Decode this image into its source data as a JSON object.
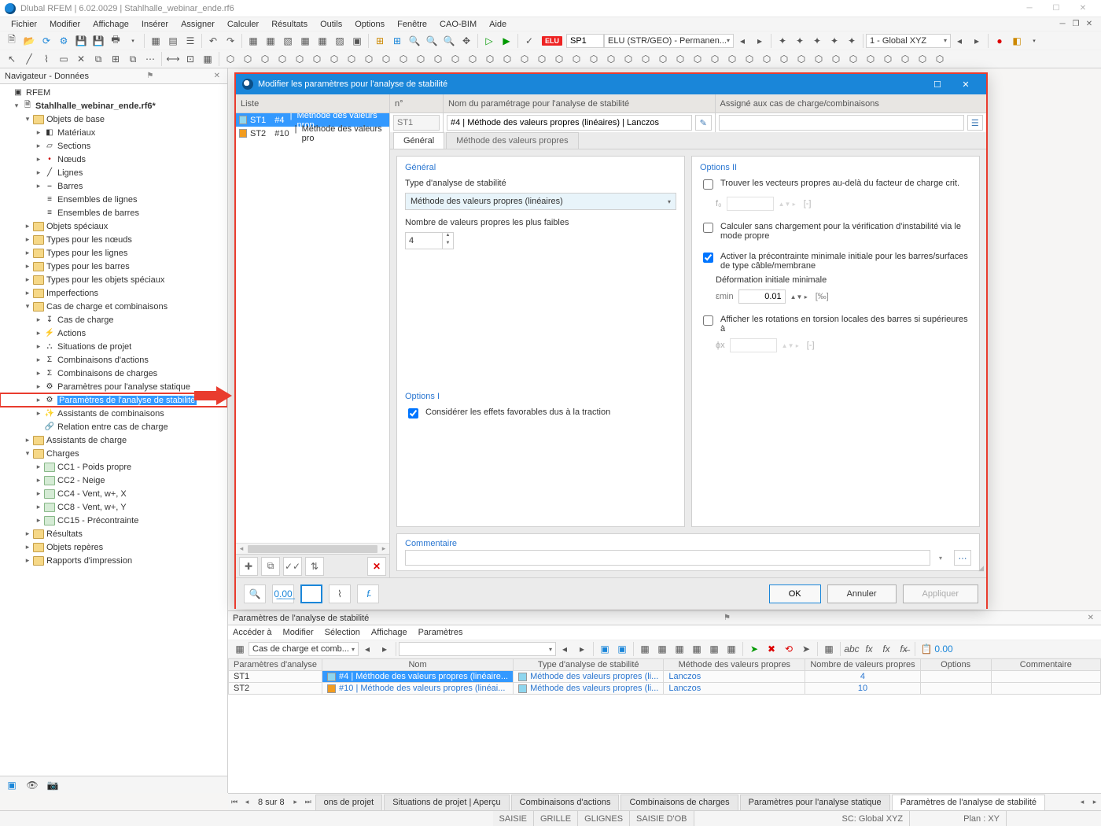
{
  "window_title": "Dlubal RFEM | 6.02.0029 | Stahlhalle_webinar_ende.rf6",
  "menus": [
    "Fichier",
    "Modifier",
    "Affichage",
    "Insérer",
    "Assigner",
    "Calculer",
    "Résultats",
    "Outils",
    "Options",
    "Fenêtre",
    "CAO-BIM",
    "Aide"
  ],
  "toolbar1": {
    "elu_label": "ELU",
    "sp_input": "SP1",
    "combo": "ELU (STR/GEO) - Permanen...",
    "coord": "1 - Global XYZ"
  },
  "navigator": {
    "title": "Navigateur - Données",
    "root": "RFEM",
    "file": "Stahlhalle_webinar_ende.rf6*",
    "objets_base": "Objets de base",
    "base_children": [
      "Matériaux",
      "Sections",
      "Nœuds",
      "Lignes",
      "Barres",
      "Ensembles de lignes",
      "Ensembles de barres"
    ],
    "others": [
      "Objets spéciaux",
      "Types pour les nœuds",
      "Types pour les lignes",
      "Types pour les barres",
      "Types pour les objets spéciaux",
      "Imperfections"
    ],
    "cas_charge": "Cas de charge et combinaisons",
    "cas_children": [
      "Cas de charge",
      "Actions",
      "Situations de projet",
      "Combinaisons d'actions",
      "Combinaisons de charges",
      "Paramètres pour l'analyse statique",
      "Paramètres de l'analyse de stabilité",
      "Assistants de combinaisons",
      "Relation entre cas de charge"
    ],
    "assistants": "Assistants de charge",
    "charges": "Charges",
    "charges_children": [
      "CC1 - Poids propre",
      "CC2 - Neige",
      "CC4 - Vent, w+, X",
      "CC8 - Vent, w+, Y",
      "CC15 - Précontrainte"
    ],
    "last": [
      "Résultats",
      "Objets repères",
      "Rapports d'impression"
    ]
  },
  "dialog": {
    "title": "Modifier les paramètres pour l'analyse de stabilité",
    "list_head": "Liste",
    "list": [
      {
        "id": "ST1",
        "num": "#4",
        "name": "Méthode des valeurs propres (linéaires) | Lanczos",
        "color": "cyan"
      },
      {
        "id": "ST2",
        "num": "#10",
        "name": "Méthode des valeurs propres (linéaires) | Lanczos",
        "color": "orange"
      }
    ],
    "cols": {
      "no_head": "n°",
      "no_val": "ST1",
      "name_head": "Nom du paramétrage pour l'analyse de stabilité",
      "name_val": "#4 | Méthode des valeurs propres (linéaires) | Lanczos",
      "assigned_head": "Assigné aux cas de charge/combinaisons",
      "assigned_val": ""
    },
    "tabs": [
      "Général",
      "Méthode des valeurs propres"
    ],
    "general_group": "Général",
    "type_label": "Type d'analyse de stabilité",
    "type_value": "Méthode des valeurs propres (linéaires)",
    "nvp_label": "Nombre de valeurs propres les plus faibles",
    "nvp_value": "4",
    "options1": "Options I",
    "opt1_1": "Considérer les effets favorables dus à la traction",
    "options2": "Options II",
    "opt2_1": "Trouver les vecteurs propres au-delà du facteur de charge crit.",
    "f0_label": "f₀",
    "f0_unit": "[-]",
    "opt2_2": "Calculer sans chargement pour la vérification d'instabilité via le mode propre",
    "opt2_3": "Activer la précontrainte minimale initiale pour les barres/surfaces de type câble/membrane",
    "deform_label": "Déformation initiale minimale",
    "emin_label": "εmin",
    "emin_val": "0.01",
    "emin_unit": "[‰]",
    "opt2_4": "Afficher les rotations en torsion locales des barres si supérieures à",
    "phix_label": "ϕx",
    "phix_unit": "[-]",
    "comment_label": "Commentaire",
    "ok": "OK",
    "cancel": "Annuler",
    "apply": "Appliquer"
  },
  "bottom": {
    "title": "Paramètres de l'analyse de stabilité",
    "menus": [
      "Accéder à",
      "Modifier",
      "Sélection",
      "Affichage",
      "Paramètres"
    ],
    "filter": "Cas de charge et comb...",
    "th": [
      "Paramètres d'analyse",
      "Nom",
      "Type d'analyse de stabilité",
      "Méthode des valeurs propres",
      "Nombre de valeurs propres",
      "Options",
      "Commentaire"
    ],
    "rows": [
      {
        "id": "ST1",
        "name": "#4 | Méthode des valeurs propres (linéaire...",
        "type": "Méthode des valeurs propres (li...",
        "meth": "Lanczos",
        "n": "4",
        "color": "cyan"
      },
      {
        "id": "ST2",
        "name": "#10 | Méthode des valeurs propres (linéai...",
        "type": "Méthode des valeurs propres (li...",
        "meth": "Lanczos",
        "n": "10",
        "color": "orange"
      }
    ],
    "pager": "8 sur 8",
    "tabs": [
      "ons de projet",
      "Situations de projet | Aperçu",
      "Combinaisons d'actions",
      "Combinaisons de charges",
      "Paramètres pour l'analyse statique",
      "Paramètres de l'analyse de stabilité"
    ]
  },
  "status": {
    "saisie": "SAISIE",
    "grille": "GRILLE",
    "glignes": "GLIGNES",
    "saisiedob": "SAISIE D'OB",
    "sc": "SC: Global XYZ",
    "plan": "Plan : XY"
  }
}
